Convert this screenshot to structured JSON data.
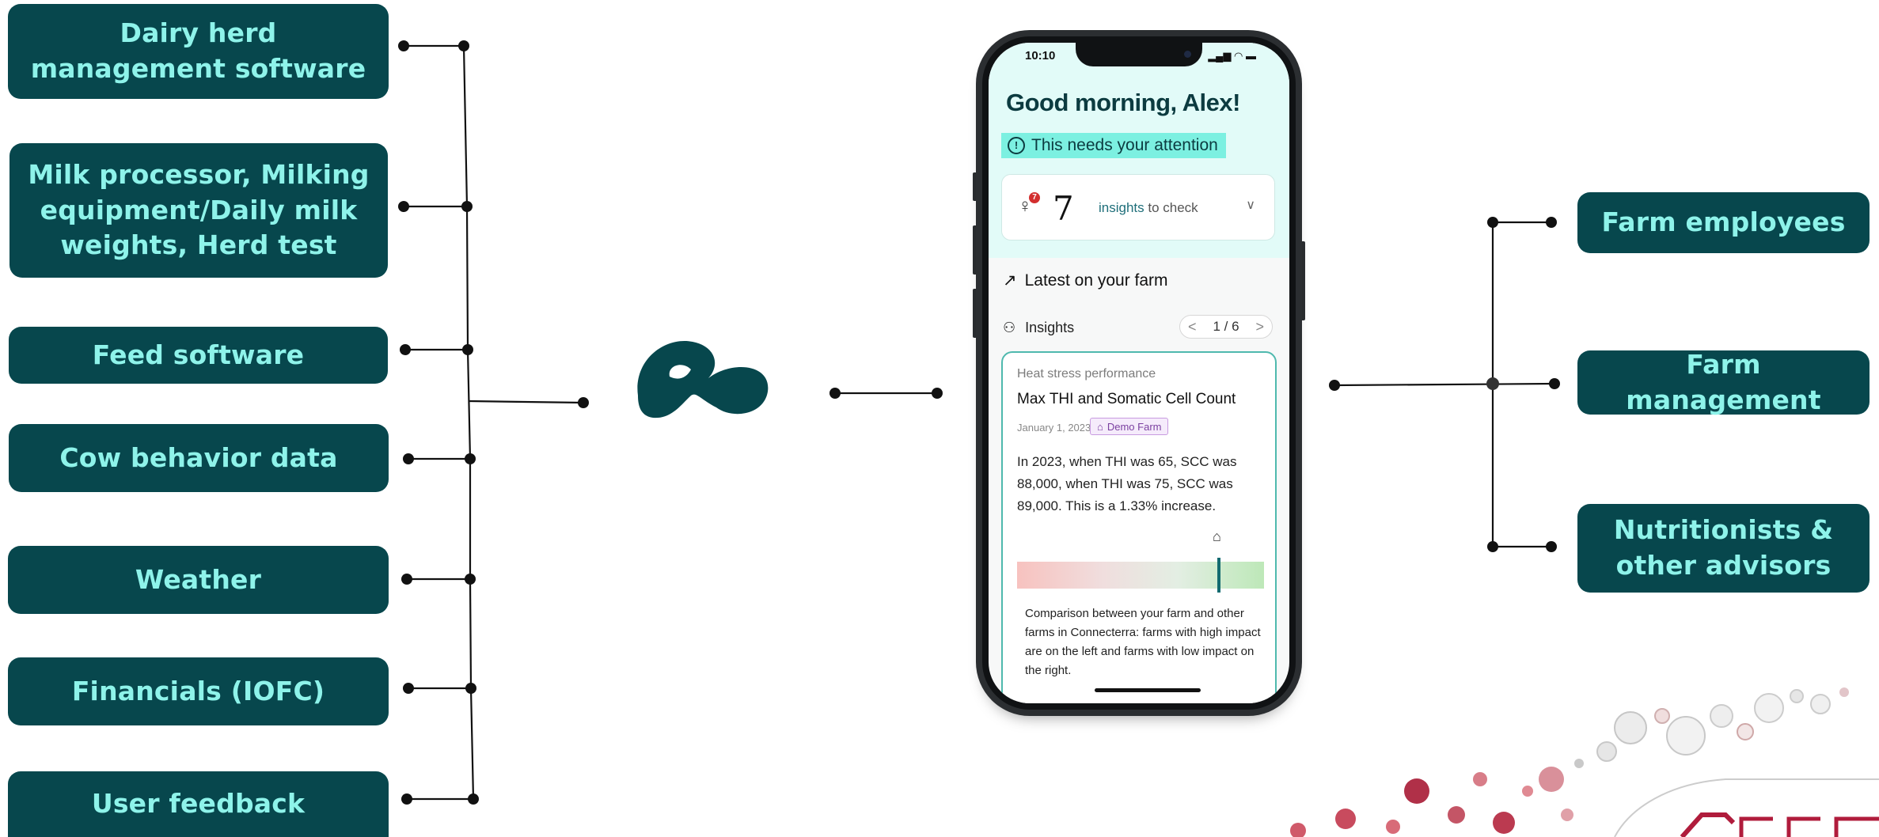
{
  "sources": [
    {
      "label": "Dairy herd management software"
    },
    {
      "label": "Milk processor, Milking equipment/Daily milk weights, Herd test"
    },
    {
      "label": "Feed software"
    },
    {
      "label": "Cow behavior data"
    },
    {
      "label": "Weather"
    },
    {
      "label": "Financials (IOFC)"
    },
    {
      "label": "User feedback"
    }
  ],
  "audiences": [
    {
      "label": "Farm employees"
    },
    {
      "label": "Farm management"
    },
    {
      "label": "Nutritionists & other advisors"
    }
  ],
  "colors": {
    "box_bg": "#07474d",
    "box_text": "#8ef3ea",
    "line": "#111111",
    "accent": "#7cf0e1"
  },
  "phone": {
    "status_time": "10:10",
    "greeting": "Good morning, Alex!",
    "attention": "This needs your attention",
    "insights_count": "7",
    "badge_count": "7",
    "insights_link": "insights",
    "insights_rest": " to check",
    "latest_title": "Latest on your farm",
    "insights_label": "Insights",
    "pager": "1 / 6",
    "card": {
      "subtitle": "Heat stress performance",
      "title": "Max THI and Somatic Cell Count",
      "date": "January 1, 2023",
      "farm_tag": "Demo Farm",
      "body": "In 2023, when THI was 65, SCC was 88,000, when THI was 75, SCC was 89,000. This is a 1.33% increase.",
      "bar_marker_fraction": 0.81,
      "footnote": "Comparison between your farm and other farms in Connecterra: farms with high impact are on the left and farms with low impact on the right."
    }
  }
}
